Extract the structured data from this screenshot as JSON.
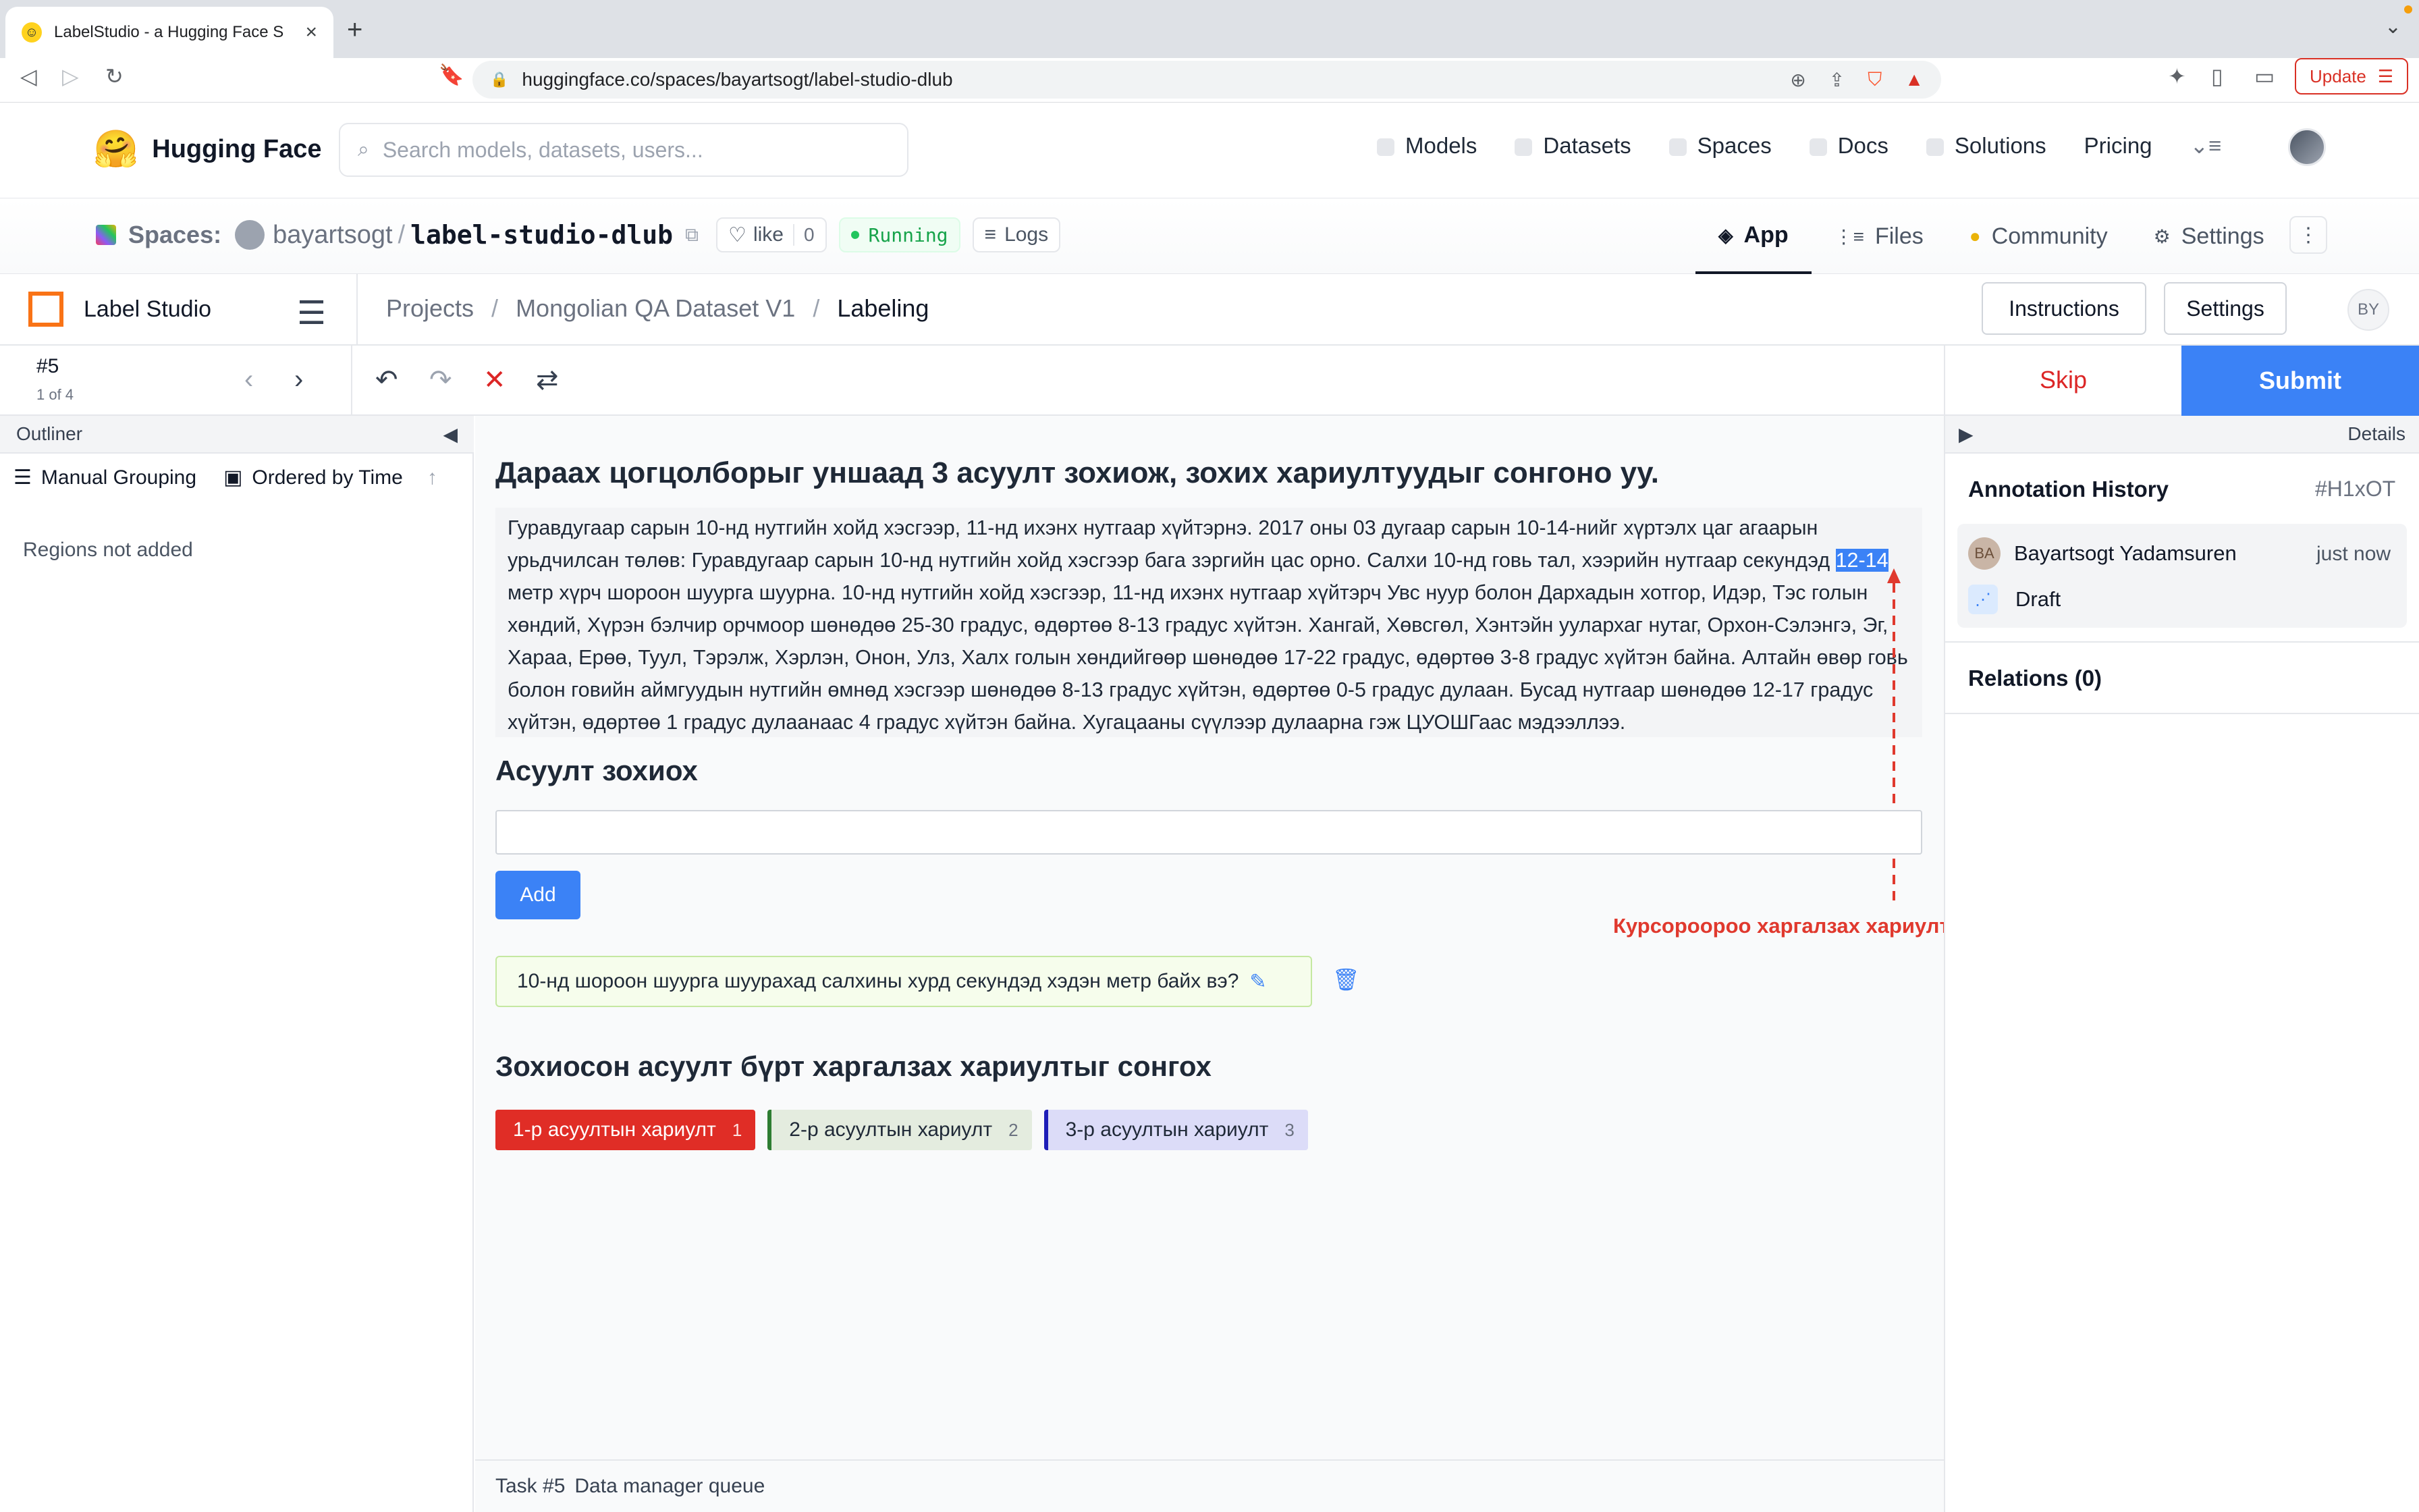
{
  "browser": {
    "tab_title": "LabelStudio - a Hugging Face S",
    "url": "huggingface.co/spaces/bayartsogt/label-studio-dlub",
    "update_label": "Update"
  },
  "hf_header": {
    "brand": "Hugging Face",
    "search_placeholder": "Search models, datasets, users...",
    "nav": [
      "Models",
      "Datasets",
      "Spaces",
      "Docs",
      "Solutions",
      "Pricing"
    ]
  },
  "space": {
    "spaces_label": "Spaces:",
    "owner": "bayartsogt",
    "slash": "/",
    "name": "label-studio-dlub",
    "like_label": "like",
    "like_count": "0",
    "status": "Running",
    "logs_label": "Logs",
    "tabs": [
      "App",
      "Files",
      "Community",
      "Settings"
    ]
  },
  "label_studio": {
    "brand": "Label Studio",
    "breadcrumb": [
      "Projects",
      "Mongolian QA Dataset V1",
      "Labeling"
    ],
    "instructions_label": "Instructions",
    "settings_label": "Settings",
    "user_initials": "BY",
    "task_id": "#5",
    "task_count": "1 of 4",
    "skip_label": "Skip",
    "submit_label": "Submit"
  },
  "outliner": {
    "title": "Outliner",
    "manual_grouping": "Manual Grouping",
    "ordered_by_time": "Ordered by Time",
    "empty": "Regions not added"
  },
  "main": {
    "title": "Дараах цогцолборыг уншаад 3 асуулт зохиож, зохих хариултуудыг сонгоно уу.",
    "passage_before": "Гуравдугаар сарын 10-нд нутгийн хойд хэсгээр, 11-нд ихэнх нутгаар хүйтэрнэ. 2017 оны 03 дугаар сарын 10-14-нийг хүртэлх цаг агаарын урьдчилсан төлөв: Гуравдугаар сарын 10-нд нутгийн хойд хэсгээр бага зэргийн цас орно. Салхи 10-нд говь тал, хээрийн нутгаар секундэд ",
    "passage_highlight": "12-14",
    "passage_after": " метр хүрч шороон шуурга шуурна. 10-нд нутгийн хойд хэсгээр, 11-нд ихэнх нутгаар хүйтэрч Увс нуур болон Дархадын хотгор, Идэр, Тэс голын хөндий, Хүрэн бэлчир орчмоор шөнөдөө 25-30 градус, өдөртөө 8-13 градус хүйтэн. Хангай, Хөвсгөл, Хэнтэйн уулархаг нутаг, Орхон-Сэлэнгэ, Эг, Хараа, Ерөө, Туул, Тэрэлж, Хэрлэн, Онон, Улз, Халх голын хөндийгөөр шөнөдөө 17-22 градус, өдөртөө 3-8 градус хүйтэн байна. Алтайн өвөр говь болон говийн аймгуудын нутгийн өмнөд хэсгээр шөнөдөө 8-13 градус хүйтэн, өдөртөө 0-5 градус дулаан. Бусад нутгаар шөнөдөө 12-17 градус хүйтэн, өдөртөө 1 градус дулаанаас 4 градус хүйтэн байна. Хугацааны сүүлээр дулаарна гэж ЦУОШГаас мэдээллээ.",
    "question_title": "Асуулт зохиох",
    "add_label": "Add",
    "question_item": "10-нд шороон шуурга шуурахад салхины хурд секундэд хэдэн метр байх вэ?",
    "answer_title": "Зохиосон асуулт бүрт харгалзах хариултыг сонгох",
    "labels": [
      {
        "text": "1-р асуултын хариулт",
        "key": "1",
        "color": "#e02d26"
      },
      {
        "text": "2-р асуултын хариулт",
        "key": "2",
        "color": "#2e7d32"
      },
      {
        "text": "3-р асуултын хариулт",
        "key": "3",
        "color": "#1e1eb8"
      }
    ],
    "annotation_note": "Курсороороо харгалзах хариултыг идэвхжүүлнэ",
    "footer_task": "Task #5",
    "footer_queue": "Data manager queue"
  },
  "details": {
    "title": "Details",
    "annotation_history": "Annotation History",
    "annotation_id": "#H1xOT",
    "user_initials": "BA",
    "user_name": "Bayartsogt Yadamsuren",
    "time": "just now",
    "draft_label": "Draft",
    "relations": "Relations (0)"
  }
}
